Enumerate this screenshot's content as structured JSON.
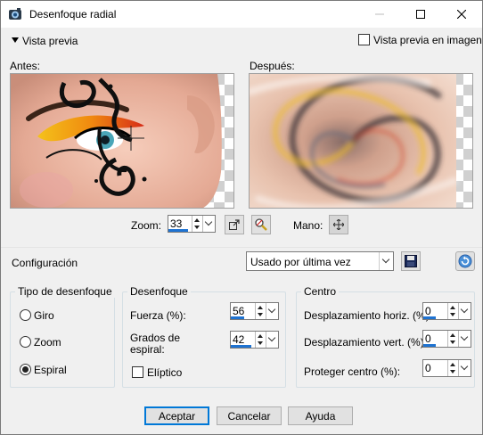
{
  "window": {
    "title": "Desenfoque radial"
  },
  "top": {
    "preview_toggle": "Vista previa",
    "preview_in_image": "Vista previa en imagen",
    "preview_in_image_checked": false
  },
  "previews": {
    "before_label": "Antes:",
    "after_label": "Después:"
  },
  "zoom": {
    "label": "Zoom:",
    "value": "33",
    "hand_label": "Mano:"
  },
  "config": {
    "label": "Configuración",
    "preset_value": "Usado por última vez"
  },
  "blur_type": {
    "title": "Tipo de desenfoque",
    "options": [
      {
        "label": "Giro",
        "checked": false
      },
      {
        "label": "Zoom",
        "checked": false
      },
      {
        "label": "Espiral",
        "checked": true
      }
    ]
  },
  "blur": {
    "title": "Desenfoque",
    "strength_label": "Fuerza (%):",
    "strength_value": "56",
    "spiral_label_1": "Grados de",
    "spiral_label_2": "espiral:",
    "spiral_value": "42",
    "elliptic_label": "Elíptico",
    "elliptic_checked": false
  },
  "center": {
    "title": "Centro",
    "hoffset_label": "Desplazamiento horiz. (%):",
    "hoffset_value": "0",
    "voffset_label": "Desplazamiento vert. (%):",
    "voffset_value": "0",
    "protect_label": "Proteger centro (%):",
    "protect_value": "0"
  },
  "buttons": {
    "ok": "Aceptar",
    "cancel": "Cancelar",
    "help": "Ayuda"
  },
  "colors": {
    "accent": "#1e73d2",
    "window_bg": "#f0f0f0"
  }
}
